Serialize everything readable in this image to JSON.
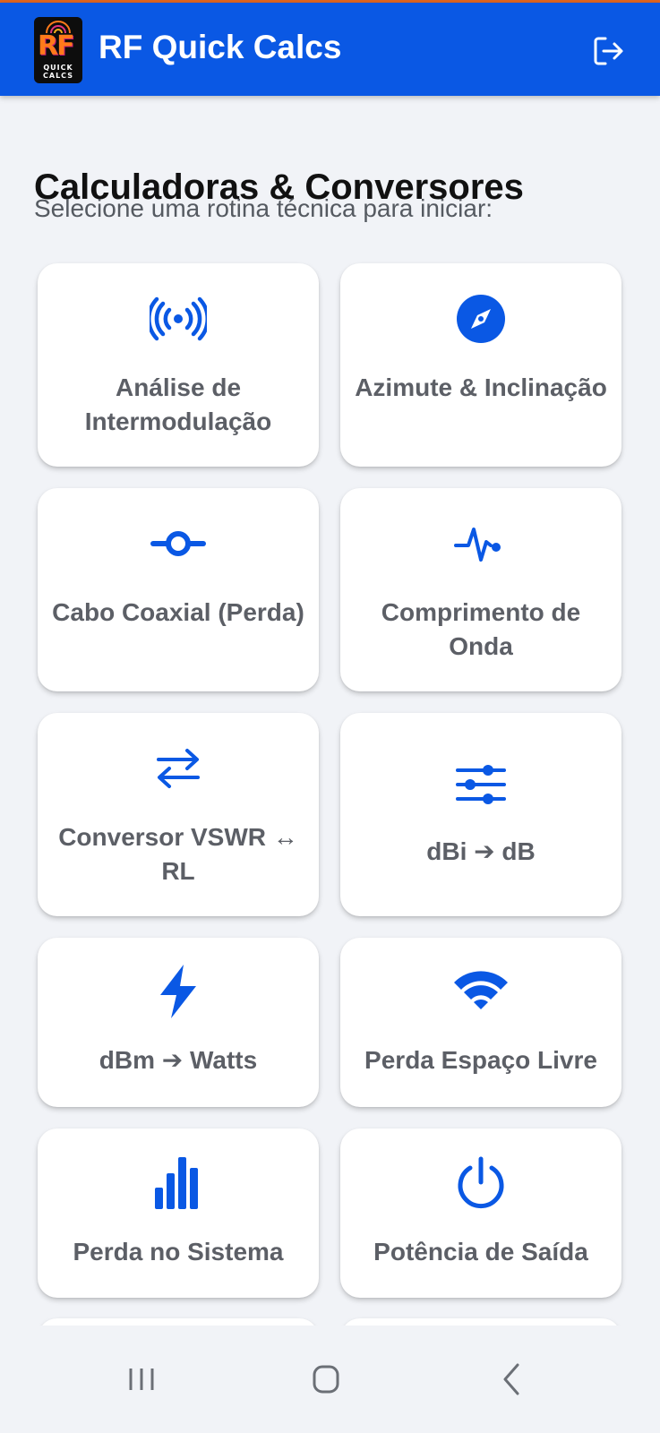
{
  "app": {
    "title": "RF Quick Calcs",
    "logo_text": "RF",
    "logo_subtext": "QUICK CALCS",
    "accent_color": "#0a58e4",
    "header_icon": "logout-icon"
  },
  "main": {
    "heading": "Calculadoras & Conversores",
    "subheading": "Selecione uma rotina técnica para iniciar:"
  },
  "cards": [
    {
      "label": "Análise de Intermodulação",
      "icon": "antenna-signal-icon"
    },
    {
      "label": "Azimute & Inclinação",
      "icon": "compass-icon"
    },
    {
      "label": "Cabo Coaxial (Perda)",
      "icon": "commit-node-icon"
    },
    {
      "label": "Comprimento de Onda",
      "icon": "pulse-wave-icon"
    },
    {
      "label": "Conversor VSWR ↔ RL",
      "icon": "swap-arrows-icon"
    },
    {
      "label": "dBi ➔ dB",
      "icon": "sliders-icon"
    },
    {
      "label": "dBm ➔ Watts",
      "icon": "lightning-bolt-icon"
    },
    {
      "label": "Perda Espaço Livre",
      "icon": "wifi-icon"
    },
    {
      "label": "Perda no Sistema",
      "icon": "bar-chart-icon"
    },
    {
      "label": "Potência de Saída",
      "icon": "power-icon"
    }
  ],
  "navbar": {
    "items": [
      "recent-apps-icon",
      "home-icon",
      "back-icon"
    ]
  }
}
